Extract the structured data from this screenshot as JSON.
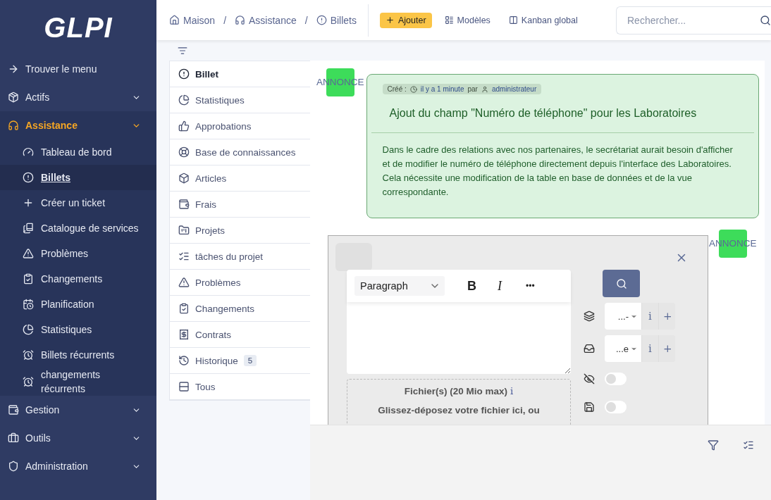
{
  "sidebar": {
    "logo": "GLPI",
    "items": [
      {
        "label": "Trouver le menu",
        "selected": false
      },
      {
        "label": "Actifs",
        "selected": false,
        "expanded": false
      },
      {
        "label": "Assistance",
        "selected": true,
        "expanded": true,
        "children": [
          {
            "label": "Tableau de bord",
            "selected": false
          },
          {
            "label": "Billets",
            "selected": true
          },
          {
            "label": "Créer un ticket",
            "selected": false
          },
          {
            "label": "Catalogue de services",
            "selected": false
          },
          {
            "label": "Problèmes",
            "selected": false
          },
          {
            "label": "Changements",
            "selected": false
          },
          {
            "label": "Planification",
            "selected": false
          },
          {
            "label": "Statistiques",
            "selected": false
          },
          {
            "label": "Billets récurrents",
            "selected": false
          },
          {
            "label": "changements récurrents",
            "selected": false
          }
        ]
      },
      {
        "label": "Gestion",
        "selected": false,
        "expanded": false
      },
      {
        "label": "Outils",
        "selected": false,
        "expanded": false
      },
      {
        "label": "Administration",
        "selected": false,
        "expanded": false
      }
    ]
  },
  "header": {
    "breadcrumb": [
      {
        "label": "Maison",
        "separator": "/"
      },
      {
        "label": "Assistance",
        "separator": "/"
      },
      {
        "label": "Billets"
      }
    ],
    "actions": [
      {
        "label": "Ajouter",
        "kind": "primary"
      },
      {
        "label": "Modèles",
        "kind": "link"
      },
      {
        "label": "Kanban global",
        "kind": "link"
      }
    ],
    "search": {
      "placeholder": "Rechercher..."
    }
  },
  "tabs": [
    {
      "label": "Billet",
      "selected": true
    },
    {
      "label": "Statistiques",
      "selected": false
    },
    {
      "label": "Approbations",
      "selected": false
    },
    {
      "label": "Base de connaissances",
      "selected": false
    },
    {
      "label": "Articles",
      "selected": false
    },
    {
      "label": "Frais",
      "selected": false
    },
    {
      "label": "Projets",
      "selected": false
    },
    {
      "label": "tâches du projet",
      "selected": false
    },
    {
      "label": "Problèmes",
      "selected": false
    },
    {
      "label": "Changements",
      "selected": false
    },
    {
      "label": "Contrats",
      "selected": false
    },
    {
      "label": "Historique",
      "selected": false,
      "badge": "5"
    },
    {
      "label": "Tous",
      "selected": false
    }
  ],
  "announcement": {
    "badge": "ANNONCE",
    "created_label": "Créé :",
    "time": "il y a 1 minute",
    "by": "par",
    "author": "administrateur",
    "title": "Ajout du champ \"Numéro de téléphone\" pour les Laboratoires",
    "body": "Dans le cadre des relations avec nos partenaires, le secrétariat aurait besoin d'afficher et de modifier le numéro de téléphone directement depuis l'interface des Laboratoires. Cela nécessite une modification de la table en base de données et de la vue correspondante."
  },
  "reply_form": {
    "badge": "ANNONCE",
    "editor": {
      "block_format": "Paragraph",
      "bold": "B",
      "italic": "I",
      "more": "•••"
    },
    "files": {
      "label": "Fichier(s) (20 Mio max)",
      "info": "i",
      "drop_text": "Glissez-déposez votre fichier ici, ou"
    },
    "fields": [
      {
        "kind": "select",
        "value": "...-",
        "info": "i",
        "add": "+"
      },
      {
        "kind": "select",
        "value": "...e",
        "info": "i",
        "add": "+"
      },
      {
        "kind": "toggle",
        "on": false
      },
      {
        "kind": "toggle",
        "on": false
      }
    ]
  }
}
